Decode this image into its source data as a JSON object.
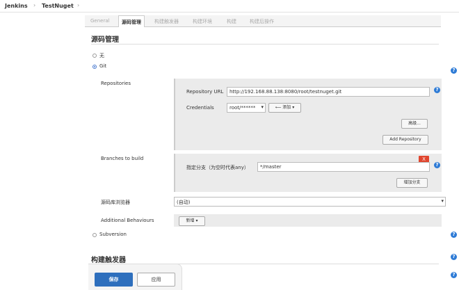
{
  "breadcrumb": {
    "root": "Jenkins",
    "sep": "›",
    "job": "TestNuget"
  },
  "tabs": [
    {
      "label": "General"
    },
    {
      "label": "源码管理"
    },
    {
      "label": "构建触发器"
    },
    {
      "label": "构建环境"
    },
    {
      "label": "构建"
    },
    {
      "label": "构建后操作"
    }
  ],
  "scm": {
    "title": "源码管理",
    "options": {
      "none": "无",
      "git": "Git",
      "svn": "Subversion"
    },
    "repositories": {
      "label": "Repositories",
      "url_label": "Repository URL",
      "url_value": "http://192.168.88.138:8080/root/testnuget.git",
      "credentials_label": "Credentials",
      "credentials_value": "root/******",
      "add_button": "添加",
      "advanced_button": "高级...",
      "add_repo_button": "Add Repository"
    },
    "branches": {
      "label": "Branches to build",
      "branch_label": "指定分支（为空时代表any）",
      "branch_value": "*/master",
      "close": "X",
      "add_branch_button": "增加分支"
    },
    "browser": {
      "label": "源码库浏览器",
      "value": "(自动)"
    },
    "behaviours": {
      "label": "Additional Behaviours",
      "button": "新增"
    }
  },
  "triggers": {
    "title": "构建触发器"
  },
  "actions": {
    "save": "保存",
    "apply": "应用"
  },
  "icons": {
    "help": "?",
    "caret": "▾",
    "add_arrow": "⟵"
  },
  "colors": {
    "help": "#2e7bd6",
    "save": "#2e6fbd",
    "remove": "#e0462f"
  }
}
